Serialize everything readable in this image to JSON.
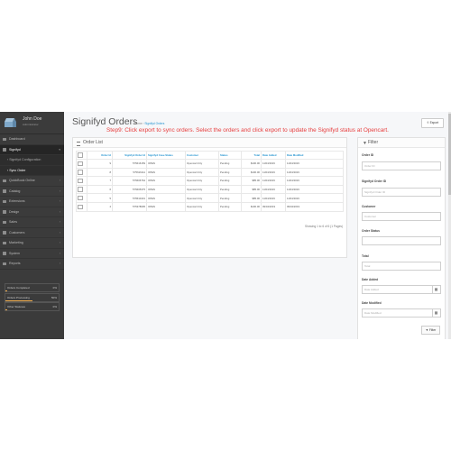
{
  "user": {
    "name": "John Doe",
    "role": "Administrator"
  },
  "sidebar": {
    "items": [
      {
        "label": "Dashboard",
        "icon": "dashboard-icon",
        "active": false,
        "sub": false
      },
      {
        "label": "Signifyd",
        "icon": "shield-icon",
        "active": true,
        "sub": false
      },
      {
        "label": "Signifyd Configuration",
        "icon": "chevron-right-icon",
        "active": false,
        "sub": true
      },
      {
        "label": "Sync Order",
        "icon": "chevron-right-icon",
        "active": true,
        "sub": true
      },
      {
        "label": "QuickBook Online",
        "icon": "book-icon",
        "active": false,
        "sub": false
      },
      {
        "label": "Catalog",
        "icon": "tag-icon",
        "active": false,
        "sub": false
      },
      {
        "label": "Extensions",
        "icon": "puzzle-icon",
        "active": false,
        "sub": false
      },
      {
        "label": "Design",
        "icon": "monitor-icon",
        "active": false,
        "sub": false
      },
      {
        "label": "Sales",
        "icon": "cart-icon",
        "active": false,
        "sub": false
      },
      {
        "label": "Customers",
        "icon": "user-icon",
        "active": false,
        "sub": false
      },
      {
        "label": "Marketing",
        "icon": "share-icon",
        "active": false,
        "sub": false
      },
      {
        "label": "System",
        "icon": "gear-icon",
        "active": false,
        "sub": false
      },
      {
        "label": "Reports",
        "icon": "bar-chart-icon",
        "active": false,
        "sub": false
      }
    ],
    "stats": [
      {
        "label": "Orders Completed",
        "value": "0%",
        "bar_color": "#f0ad4e",
        "fill": 0.0
      },
      {
        "label": "Orders Processing",
        "value": "50%",
        "bar_color": "#f0ad4e",
        "fill": 0.5
      },
      {
        "label": "Other Statuses",
        "value": "0%",
        "bar_color": "#f0ad4e",
        "fill": 0.0
      }
    ]
  },
  "header": {
    "title": "Signifyd Orders",
    "breadcrumb": [
      "Home",
      "Signifyd Orders"
    ],
    "export_label": "Export",
    "step_note": "Step9: Click export to sync orders. Select the orders and click export to update the Signifyd status at Opencart."
  },
  "orders": {
    "panel_title": "Order List",
    "columns": [
      "Order Id",
      "Signifyd Order Id",
      "Signifyd Case Status",
      "Customer",
      "Status",
      "Total",
      "Date Added",
      "Date Modified"
    ],
    "rows": [
      [
        "9",
        "575616159",
        "OPEN",
        "Opencart City",
        "Pending",
        "$100.00",
        "11/04/2019",
        "11/04/2019"
      ],
      [
        "8",
        "575616111",
        "OPEN",
        "Opencart City",
        "Pending",
        "$100.00",
        "11/04/2019",
        "11/04/2019"
      ],
      [
        "7",
        "575606764",
        "OPEN",
        "Opencart City",
        "Pending",
        "$85.00",
        "11/04/2019",
        "11/04/2019"
      ],
      [
        "6",
        "575605375",
        "OPEN",
        "Opencart City",
        "Pending",
        "$85.00",
        "11/04/2019",
        "11/04/2019"
      ],
      [
        "5",
        "575510431",
        "OPEN",
        "Opencart City",
        "Pending",
        "$85.00",
        "11/04/2019",
        "11/04/2019"
      ],
      [
        "4",
        "575378695",
        "OPEN",
        "Opencart City",
        "Pending",
        "$100.00",
        "09/04/2019",
        "09/04/2019"
      ]
    ],
    "showing": "Showing 1 to 6 of 6 (1 Pages)"
  },
  "filter": {
    "title": "Filter",
    "fields": [
      {
        "label": "Order ID",
        "placeholder": "Order ID"
      },
      {
        "label": "Signifyd Order ID",
        "placeholder": "Signifyd Order ID"
      },
      {
        "label": "Customer",
        "placeholder": "Customer"
      },
      {
        "label": "Order Status",
        "placeholder": ""
      },
      {
        "label": "Total",
        "placeholder": "Total"
      },
      {
        "label": "Date Added",
        "placeholder": "Date Added"
      },
      {
        "label": "Date Modified",
        "placeholder": "Date Modified"
      }
    ],
    "button_label": "Filter"
  }
}
